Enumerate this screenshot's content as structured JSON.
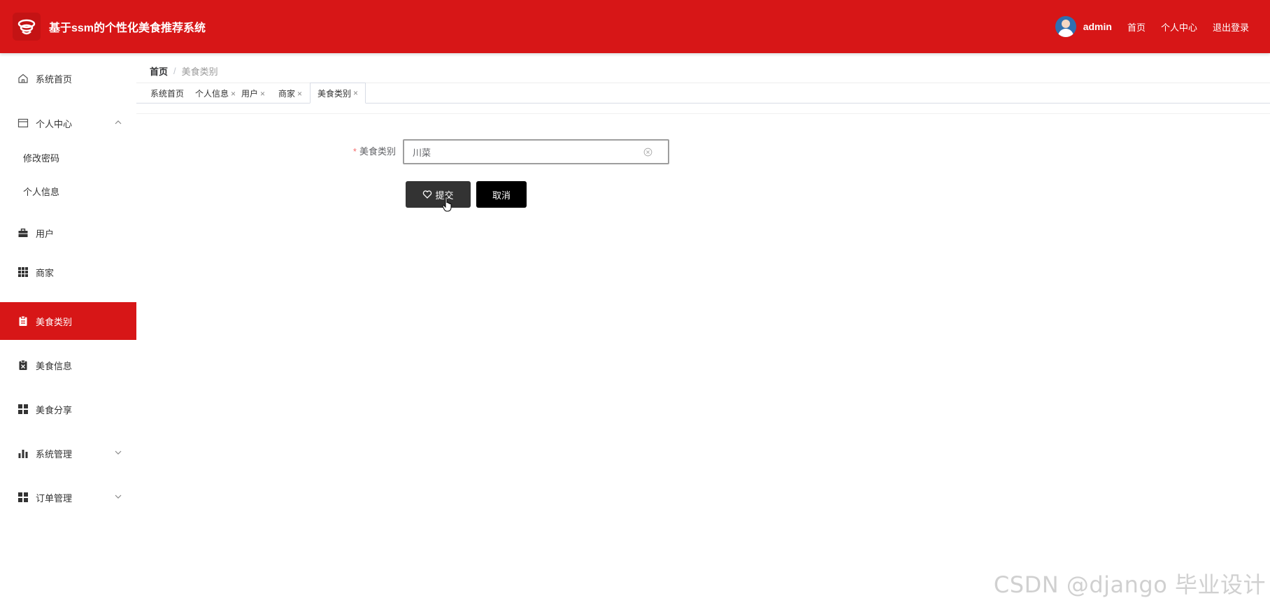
{
  "header": {
    "title": "基于ssm的个性化美食推荐系统",
    "username": "admin",
    "links": [
      "首页",
      "个人中心",
      "退出登录"
    ],
    "brand_color": "#d71617"
  },
  "sidebar": {
    "items": [
      {
        "label": "系统首页",
        "icon": "home-icon"
      },
      {
        "label": "个人中心",
        "icon": "card-icon",
        "expanded": true,
        "children": [
          {
            "label": "修改密码"
          },
          {
            "label": "个人信息"
          }
        ]
      },
      {
        "label": "用户",
        "icon": "briefcase-icon"
      },
      {
        "label": "商家",
        "icon": "grid-icon"
      },
      {
        "label": "美食类别",
        "icon": "clipboard-icon",
        "active": true
      },
      {
        "label": "美食信息",
        "icon": "clipboard-x-icon"
      },
      {
        "label": "美食分享",
        "icon": "apps-icon"
      },
      {
        "label": "系统管理",
        "icon": "bar-chart-icon",
        "expanded": false
      },
      {
        "label": "订单管理",
        "icon": "apps-icon",
        "expanded": false
      }
    ]
  },
  "breadcrumb": {
    "home": "首页",
    "separator": "/",
    "current": "美食类别"
  },
  "tabs": [
    {
      "label": "系统首页",
      "closable": false
    },
    {
      "label": "个人信息",
      "closable": true
    },
    {
      "label": "用户",
      "closable": true
    },
    {
      "label": "商家",
      "closable": true
    },
    {
      "label": "美食类别",
      "closable": true,
      "active": true
    }
  ],
  "tab_close_glyph": "×",
  "form": {
    "required_mark": "*",
    "field_label": "美食类别",
    "field_value": "川菜",
    "submit_label": "提交",
    "cancel_label": "取消"
  },
  "watermark": "CSDN @django 毕业设计"
}
